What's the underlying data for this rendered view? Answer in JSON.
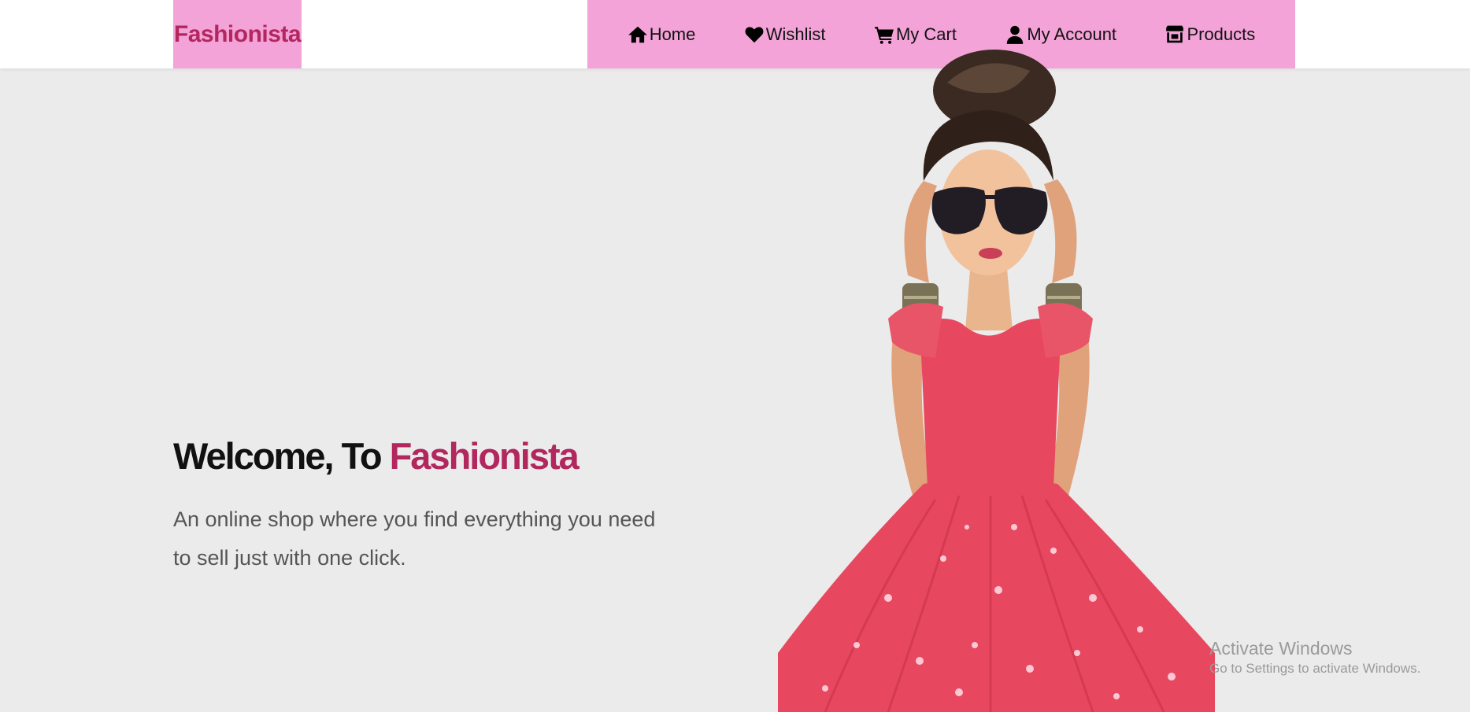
{
  "brand": {
    "name": "Fashionista"
  },
  "nav": {
    "items": [
      {
        "label": "Home",
        "icon": "home-icon"
      },
      {
        "label": "Wishlist",
        "icon": "heart-icon"
      },
      {
        "label": "My Cart",
        "icon": "cart-icon"
      },
      {
        "label": "My Account",
        "icon": "user-icon"
      },
      {
        "label": "Products",
        "icon": "store-icon"
      }
    ]
  },
  "hero": {
    "title_prefix": "Welcome, To ",
    "title_accent": "Fashionista",
    "subtitle": "An online shop where you find everything you need to sell just with one click.",
    "illustration": "fashion-girl-illustration"
  },
  "watermark": {
    "title": "Activate Windows",
    "subtitle": "Go to Settings to activate Windows."
  },
  "colors": {
    "accent": "#b2275e",
    "nav_background": "#f4a3d8",
    "page_background": "#ebebeb",
    "dress": "#e8485f"
  }
}
